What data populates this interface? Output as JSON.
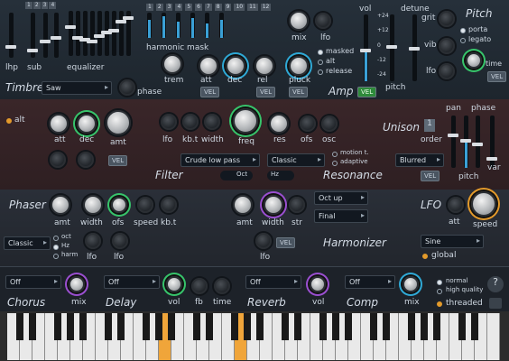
{
  "osc": {
    "tabs": [
      "1",
      "2",
      "3",
      "4",
      "5",
      "6",
      "7",
      "8",
      "9",
      "10",
      "11",
      "12"
    ],
    "labels": {
      "lhp": "lhp",
      "sub": "sub",
      "equalizer": "equalizer",
      "harmonic_mask": "harmonic mask",
      "mix": "mix",
      "lfo": "lfo",
      "trem": "trem",
      "att": "att",
      "dec": "dec",
      "rel": "rel",
      "pluck": "pluck",
      "vol": "vol",
      "pitch": "pitch",
      "detune": "detune",
      "grit": "grit",
      "vib": "vib",
      "lfo2": "lfo",
      "time": "time"
    },
    "section_timbre": "Timbre",
    "timbre_value": "Saw",
    "phase": "phase",
    "section_amp": "Amp",
    "section_pitch": "Pitch",
    "modes": [
      "masked",
      "alt",
      "release"
    ],
    "pitch_modes": [
      "porta",
      "legato"
    ],
    "scale_top": "+24",
    "scale_mid": "+12",
    "scale_zero": "0",
    "scale_bot": "-12",
    "scale_btm": "-24",
    "vel": "VEL"
  },
  "filter": {
    "alt": "alt",
    "att": "att",
    "dec": "dec",
    "amt": "amt",
    "lfo": "lfo",
    "kbt": "kb.t",
    "width": "width",
    "freq": "freq",
    "res": "res",
    "ofs": "ofs",
    "osc": "osc",
    "section": "Filter",
    "type": "Crude low pass",
    "oct": "Oct",
    "section_res": "Resonance",
    "res_mode": "Classic",
    "hz": "Hz",
    "motion": "motion t.",
    "adaptive": "adaptive",
    "vel": "VEL"
  },
  "unison": {
    "section": "Unison",
    "count": "1",
    "order": "order",
    "pan": "pan",
    "phase": "phase",
    "pitch": "pitch",
    "var": "var",
    "mode": "Blurred",
    "vel": "VEL"
  },
  "phaser": {
    "section": "Phaser",
    "amt": "amt",
    "width": "width",
    "ofs": "ofs",
    "speed": "speed",
    "kbt": "kb.t",
    "mode": "Classic",
    "oct": "oct",
    "hz": "Hz",
    "harm": "harm",
    "lfo": "lfo",
    "lfo2": "lfo"
  },
  "harmonizer": {
    "amt": "amt",
    "width": "width",
    "str": "str",
    "section": "Harmonizer",
    "lfo": "lfo",
    "dd1": "Oct up",
    "dd2": "Final",
    "vel": "VEL"
  },
  "lfo": {
    "section": "LFO",
    "att": "att",
    "speed": "speed",
    "shape": "Sine",
    "global": "global"
  },
  "fx": {
    "chorus": {
      "name": "Chorus",
      "val": "Off",
      "mix": "mix"
    },
    "delay": {
      "name": "Delay",
      "val": "Off",
      "vol": "vol",
      "fb": "fb",
      "time": "time"
    },
    "reverb": {
      "name": "Reverb",
      "val": "Off",
      "vol": "vol"
    },
    "comp": {
      "name": "Comp",
      "val": "Off",
      "mix": "mix"
    },
    "quality": [
      "normal",
      "high quality"
    ],
    "threaded": "threaded",
    "help": "?"
  }
}
